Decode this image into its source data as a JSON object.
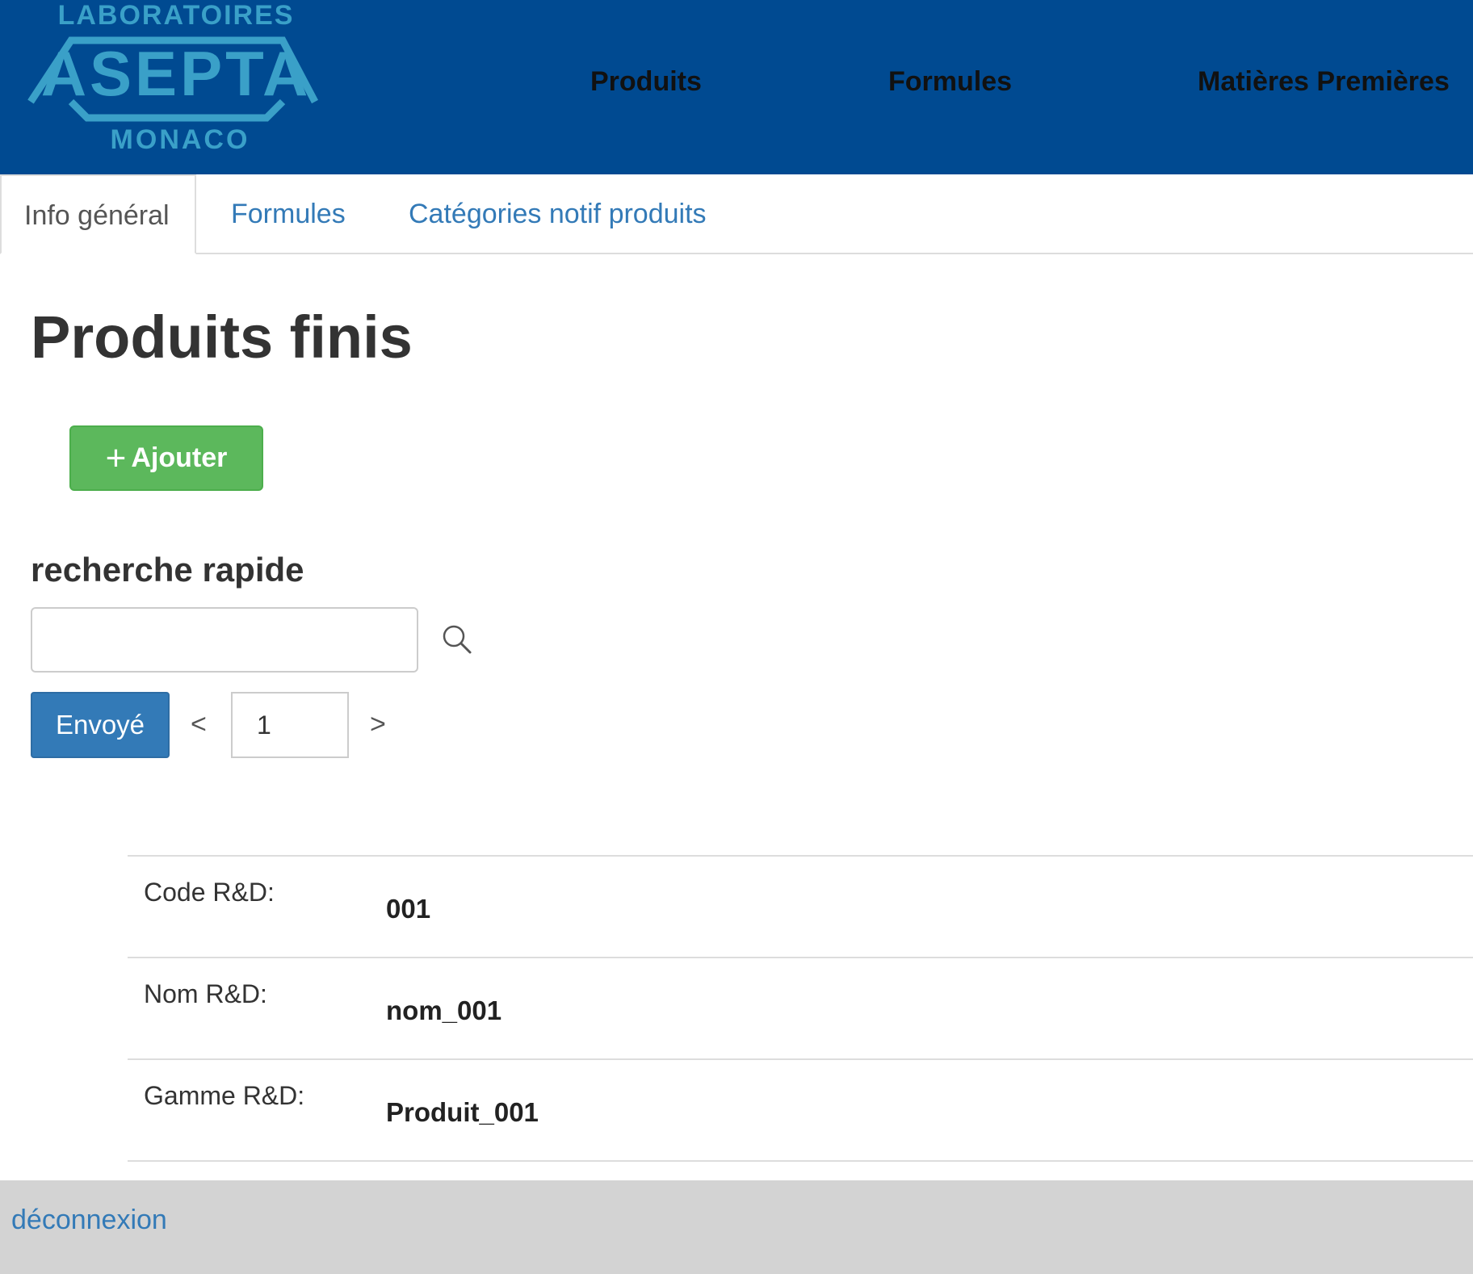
{
  "colors": {
    "header_bg": "#004a91",
    "logo": "#3aa0c8",
    "link": "#337ab7",
    "add_button": "#5cb85c",
    "send_button": "#337ab7",
    "footer_bg": "#d3d3d3"
  },
  "header": {
    "logo": {
      "top_text": "LABORATOIRES",
      "main_text": "ASEPTA",
      "bottom_text": "MONACO"
    },
    "nav": {
      "produits": "Produits",
      "formules": "Formules",
      "matieres": "Matières Premières"
    }
  },
  "tabs": {
    "info": "Info général",
    "formules": "Formules",
    "categories": "Catégories notif produits"
  },
  "main": {
    "title": "Produits finis",
    "add_button": "Ajouter",
    "add_icon": "plus-icon",
    "search": {
      "title": "recherche rapide",
      "value": "",
      "placeholder": "",
      "icon": "search-icon"
    },
    "send_button": "Envoyé",
    "pager": {
      "prev": "<",
      "next": ">",
      "page": "1"
    },
    "details": [
      {
        "label": "Code R&D:",
        "value": "001"
      },
      {
        "label": "Nom R&D:",
        "value": "nom_001"
      },
      {
        "label": "Gamme R&D:",
        "value": "Produit_001"
      }
    ]
  },
  "footer": {
    "logout": "déconnexion"
  }
}
